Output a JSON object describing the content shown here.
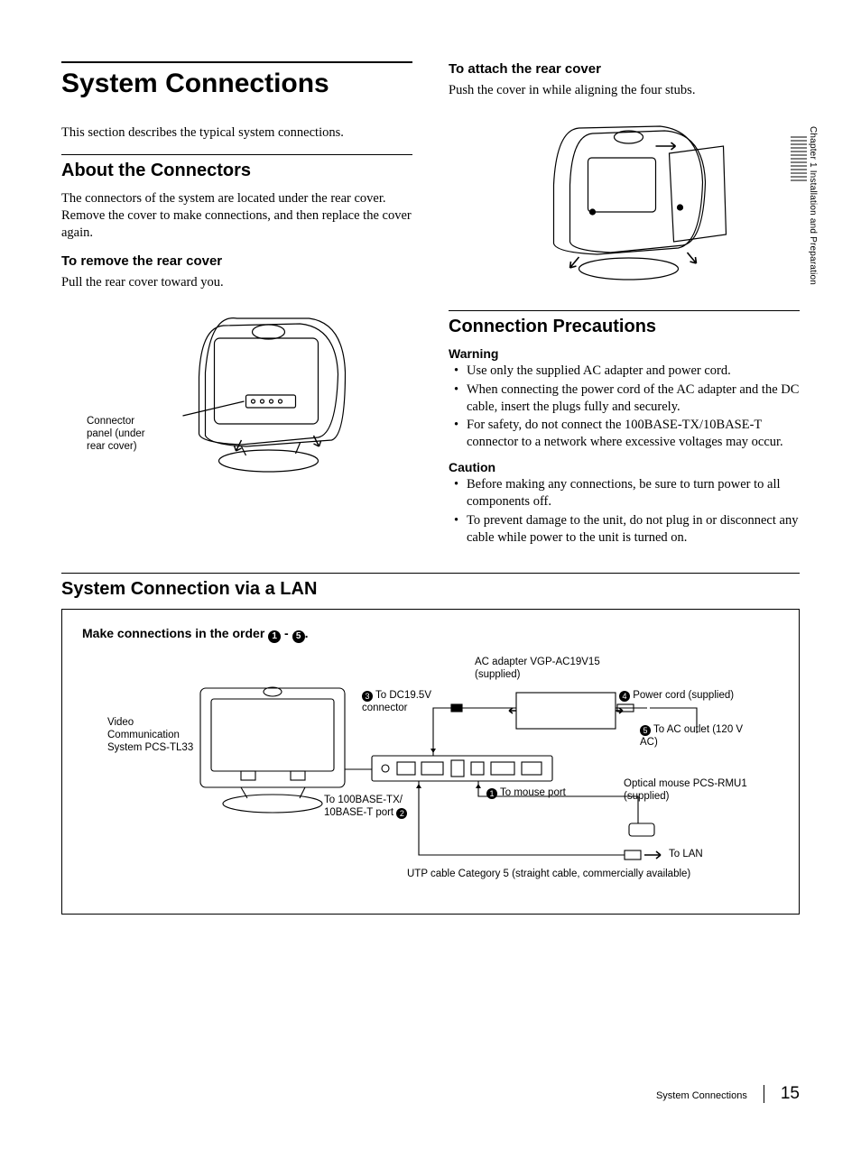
{
  "sideTab": "Chapter 1  Installation and Preparation",
  "main": {
    "title": "System Connections",
    "intro": "This section describes the typical system connections."
  },
  "about": {
    "heading": "About the Connectors",
    "body": "The connectors of the system are located under the rear cover. Remove the cover to make connections, and then replace the cover again.",
    "remove": {
      "heading": "To remove the rear cover",
      "body": "Pull the rear cover toward you.",
      "callout": "Connector panel (under rear cover)"
    }
  },
  "attach": {
    "heading": "To attach the rear cover",
    "body": "Push the cover in while aligning the four stubs."
  },
  "precautions": {
    "heading": "Connection Precautions",
    "warningLabel": "Warning",
    "warnings": [
      "Use only the supplied AC adapter and power cord.",
      "When connecting the power cord of the AC adapter and the DC cable, insert the plugs fully and securely.",
      "For safety, do not connect the 100BASE-TX/10BASE-T connector to a network where excessive voltages may occur."
    ],
    "cautionLabel": "Caution",
    "cautions": [
      "Before making any connections, be sure to turn power to all components off.",
      "To prevent damage to the unit, do not plug in or disconnect any cable while power to the unit is turned on."
    ]
  },
  "lan": {
    "heading": "System Connection via a LAN",
    "order": {
      "prefix": "Make connections in the order ",
      "from": "1",
      "sep": " - ",
      "to": "5",
      "suffix": "."
    },
    "labels": {
      "adapter": "AC adapter VGP-AC19V15 (supplied)",
      "dc": "To DC19.5V connector",
      "powercord": "Power cord (supplied)",
      "outlet": "To AC outlet (120 V AC)",
      "mouse": "To mouse port",
      "mouseDev": "Optical mouse PCS-RMU1 (supplied)",
      "system": "Video Communication System PCS-TL33",
      "base": "To 100BASE-TX/ 10BASE-T port",
      "toLAN": "To LAN",
      "utp": "UTP cable Category 5 (straight cable, commercially available)",
      "n1": "1",
      "n2": "2",
      "n3": "3",
      "n4": "4",
      "n5": "5"
    },
    "chart_data": {
      "type": "diagram",
      "nodes": [
        {
          "id": "system",
          "label": "Video Communication System PCS-TL33"
        },
        {
          "id": "connector_panel",
          "ports": [
            "mouse",
            "100BASE-TX/10BASE-T",
            "DC19.5V"
          ]
        },
        {
          "id": "ac_adapter",
          "label": "AC adapter VGP-AC19V15 (supplied)"
        },
        {
          "id": "power_cord",
          "label": "Power cord (supplied)"
        },
        {
          "id": "ac_outlet",
          "label": "AC outlet (120 V AC)"
        },
        {
          "id": "mouse",
          "label": "Optical mouse PCS-RMU1 (supplied)"
        },
        {
          "id": "lan",
          "label": "LAN"
        }
      ],
      "connections": [
        {
          "order": 1,
          "from": "mouse",
          "to": "connector_panel.mouse",
          "label": "To mouse port"
        },
        {
          "order": 2,
          "from": "lan",
          "via": "UTP cable Category 5 (straight cable, commercially available)",
          "to": "connector_panel.100BASE-TX/10BASE-T",
          "label": "To 100BASE-TX/10BASE-T port"
        },
        {
          "order": 3,
          "from": "ac_adapter",
          "to": "connector_panel.DC19.5V",
          "label": "To DC19.5V connector"
        },
        {
          "order": 4,
          "from": "power_cord",
          "to": "ac_adapter",
          "label": "Power cord (supplied)"
        },
        {
          "order": 5,
          "from": "power_cord",
          "to": "ac_outlet",
          "label": "To AC outlet (120 V AC)"
        }
      ]
    }
  },
  "footer": {
    "label": "System Connections",
    "page": "15"
  }
}
